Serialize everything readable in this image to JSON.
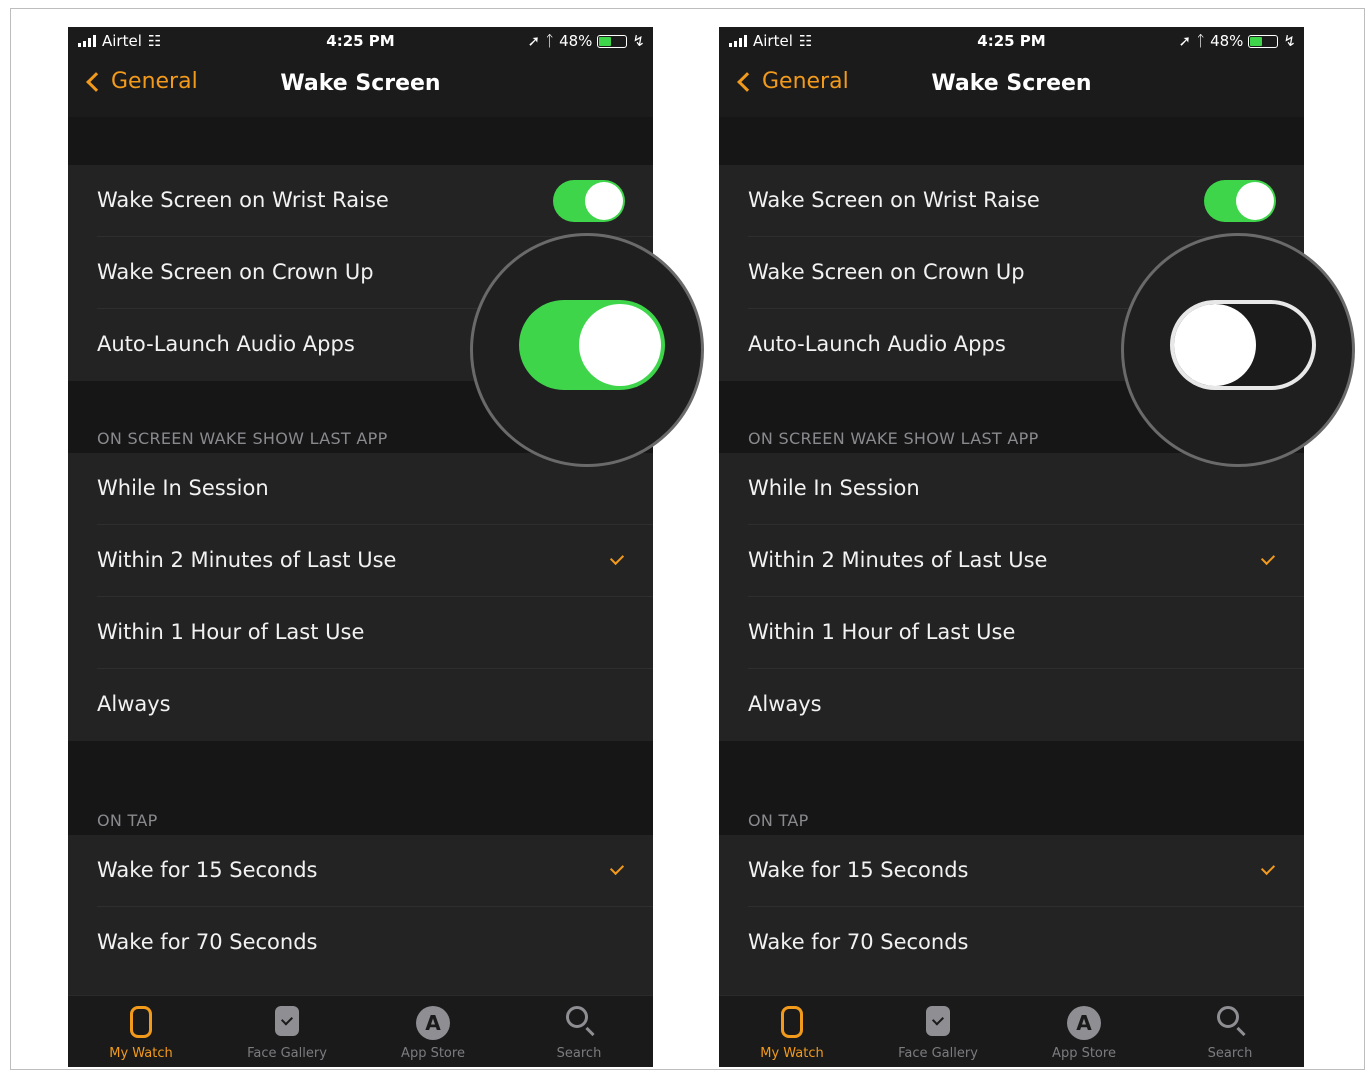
{
  "colors": {
    "accent": "#f19a1c",
    "toggle_on": "#3ed54a",
    "background": "#1b1b1c"
  },
  "phones": [
    {
      "status": {
        "carrier": "Airtel",
        "time": "4:25 PM",
        "battery": "48%"
      },
      "nav": {
        "back": "General",
        "title": "Wake Screen"
      },
      "toggles": {
        "wrist_raise": {
          "label": "Wake Screen on Wrist Raise",
          "state": "on"
        },
        "crown_up": {
          "label": "Wake Screen on Crown Up",
          "state": "on"
        },
        "audio_apps": {
          "label": "Auto-Launch Audio Apps",
          "state": "on"
        }
      },
      "section1": {
        "header": "ON SCREEN WAKE SHOW LAST APP",
        "options": [
          "While In Session",
          "Within 2 Minutes of Last Use",
          "Within 1 Hour of Last Use",
          "Always"
        ],
        "selected": 1
      },
      "section2": {
        "header": "ON TAP",
        "options": [
          "Wake for 15 Seconds",
          "Wake for 70 Seconds"
        ],
        "selected": 0
      },
      "tabs": [
        {
          "label": "My Watch",
          "icon": "watch-icon",
          "active": true
        },
        {
          "label": "Face Gallery",
          "icon": "face-gallery-icon",
          "active": false
        },
        {
          "label": "App Store",
          "icon": "app-store-icon",
          "active": false
        },
        {
          "label": "Search",
          "icon": "search-icon",
          "active": false
        }
      ]
    },
    {
      "status": {
        "carrier": "Airtel",
        "time": "4:25 PM",
        "battery": "48%"
      },
      "nav": {
        "back": "General",
        "title": "Wake Screen"
      },
      "toggles": {
        "wrist_raise": {
          "label": "Wake Screen on Wrist Raise",
          "state": "on"
        },
        "crown_up": {
          "label": "Wake Screen on Crown Up",
          "state": "on"
        },
        "audio_apps": {
          "label": "Auto-Launch Audio Apps",
          "state": "off"
        }
      },
      "section1": {
        "header": "ON SCREEN WAKE SHOW LAST APP",
        "options": [
          "While In Session",
          "Within 2 Minutes of Last Use",
          "Within 1 Hour of Last Use",
          "Always"
        ],
        "selected": 1
      },
      "section2": {
        "header": "ON TAP",
        "options": [
          "Wake for 15 Seconds",
          "Wake for 70 Seconds"
        ],
        "selected": 0
      },
      "tabs": [
        {
          "label": "My Watch",
          "icon": "watch-icon",
          "active": true
        },
        {
          "label": "Face Gallery",
          "icon": "face-gallery-icon",
          "active": false
        },
        {
          "label": "App Store",
          "icon": "app-store-icon",
          "active": false
        },
        {
          "label": "Search",
          "icon": "search-icon",
          "active": false
        }
      ]
    }
  ]
}
